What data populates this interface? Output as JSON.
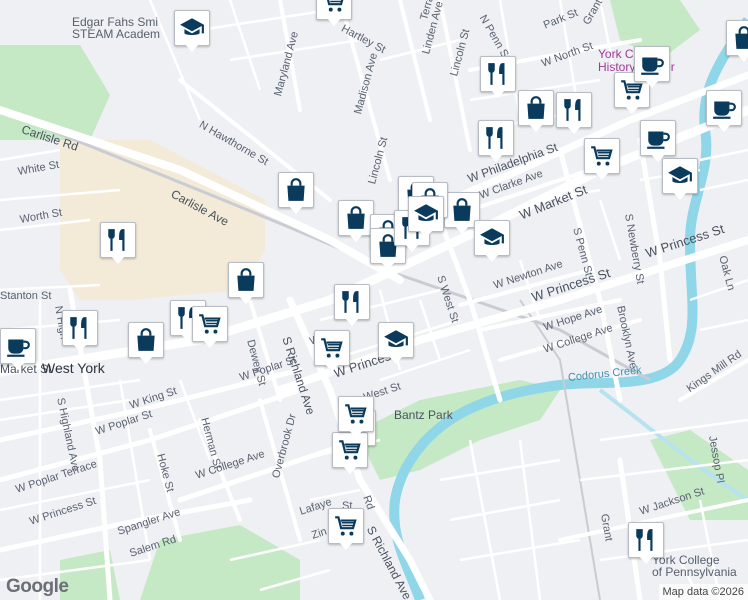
{
  "map": {
    "attribution": "Map data ©2026",
    "logo": "Google",
    "colors": {
      "background": "#eef0f3",
      "road": "#ffffff",
      "road_major": "#ffffff",
      "park": "#c5e8c5",
      "campus": "#f3ead8",
      "water": "#8ed6e8",
      "railway": "#c9ccd3",
      "marker_icon": "#0a3a5c"
    }
  },
  "labels": {
    "edgar_fahs": "Edgar Fahs Smi\nSTEAM Academ",
    "hartley_st": "Hartley St",
    "maryland_ave": "Maryland Ave",
    "madison_ave": "Madison Ave",
    "terrace": "Terrace",
    "linden_ave": "Linden Ave",
    "n_penn_st": "N Penn St",
    "park_st": "Park St",
    "grant_st": "Grant St",
    "w_north_st": "W North St",
    "lincoln_st_n": "Lincoln St",
    "york_county_history": "York County\nHistory Center",
    "carlisle_rd": "Carlisle Rd",
    "n_hawthorne_st": "N Hawthorne St",
    "lincoln_st": "Lincoln St",
    "w_philadelphia_st": "W Philadelphia St",
    "w_clarke_ave": "W Clarke Ave",
    "w_market_st": "W Market St",
    "white_st": "White St",
    "carlisle_ave": "Carlisle Ave",
    "worth_st": "Worth St",
    "s_penn_st": "S Penn St",
    "s_newberry_st": "S Newberry St",
    "w_princess_st_e": "W Princess St",
    "oak_ln": "Oak Ln",
    "s_west_st": "S West St",
    "w_newton_ave": "W Newton Ave",
    "w_princess_st_mid": "W Princess St",
    "w_hope_ave": "W Hope Ave",
    "brooklyn_ave": "Brooklyn Ave",
    "w_college_ave_e": "W College Ave",
    "stanton_st": "Stanton St",
    "n_highland": "N High",
    "w_market_st_w": "Market St",
    "west_york": "West York",
    "dewey_st": "Dewey St",
    "s_richland_ave": "S Richland Ave",
    "w_poplar_st": "W Poplar St",
    "w_princess_st_w": "W Princess St",
    "w_ma": "W Ma",
    "codorus_creek": "Codorus Creek",
    "kings_mill_rd": "Kings Mill Rd",
    "west_st": "West St",
    "bantz_park": "Bantz Park",
    "w_king_st": "W King St",
    "s_highland_ave": "S Highland Ave",
    "w_poplar_st_w": "W Poplar St",
    "herman_st": "Herman St",
    "hoke_st": "Hoke St",
    "w_college_ave": "W College Ave",
    "overbrook_dr": "Overbrook Dr",
    "w_poplar_terrace": "W Poplar Terrace",
    "w_princess_st_sw": "W Princess St",
    "spangler_ave": "Spangler Ave",
    "salem_rd": "Salem Rd",
    "lafayette_st": "Lafaye",
    "s_richland_ave_s": "S Richland Ave",
    "w_jackson_st": "W Jackson St",
    "jessop_pl": "Jessop Pl",
    "grantley": "Grant",
    "york_college": "York College\nof Pennsylvania",
    "zin": "Zin",
    "st": "St",
    "rd": "Rd"
  },
  "markers": [
    {
      "icon": "school"
    },
    {
      "icon": "grocery"
    },
    {
      "icon": "cafe"
    },
    {
      "icon": "restaurant"
    },
    {
      "icon": "shopping"
    },
    {
      "icon": "grocery"
    },
    {
      "icon": "restaurant"
    },
    {
      "icon": "cafe"
    },
    {
      "icon": "restaurant"
    },
    {
      "icon": "grocery"
    },
    {
      "icon": "cafe"
    },
    {
      "icon": "school"
    },
    {
      "icon": "shopping"
    },
    {
      "icon": "shopping"
    },
    {
      "icon": "shopping"
    },
    {
      "icon": "shopping"
    },
    {
      "icon": "shopping"
    },
    {
      "icon": "restaurant"
    },
    {
      "icon": "shopping"
    },
    {
      "icon": "school"
    },
    {
      "icon": "restaurant"
    },
    {
      "icon": "shopping"
    },
    {
      "icon": "restaurant"
    },
    {
      "icon": "shopping"
    },
    {
      "icon": "restaurant"
    },
    {
      "icon": "grocery"
    },
    {
      "icon": "restaurant"
    },
    {
      "icon": "grocery"
    },
    {
      "icon": "grocery"
    },
    {
      "icon": "school"
    },
    {
      "icon": "cafe"
    },
    {
      "icon": "shopping"
    },
    {
      "icon": "grocery"
    },
    {
      "icon": "grocery"
    },
    {
      "icon": "grocery"
    },
    {
      "icon": "restaurant"
    },
    {
      "icon": "school"
    },
    {
      "icon": "shopping"
    }
  ]
}
